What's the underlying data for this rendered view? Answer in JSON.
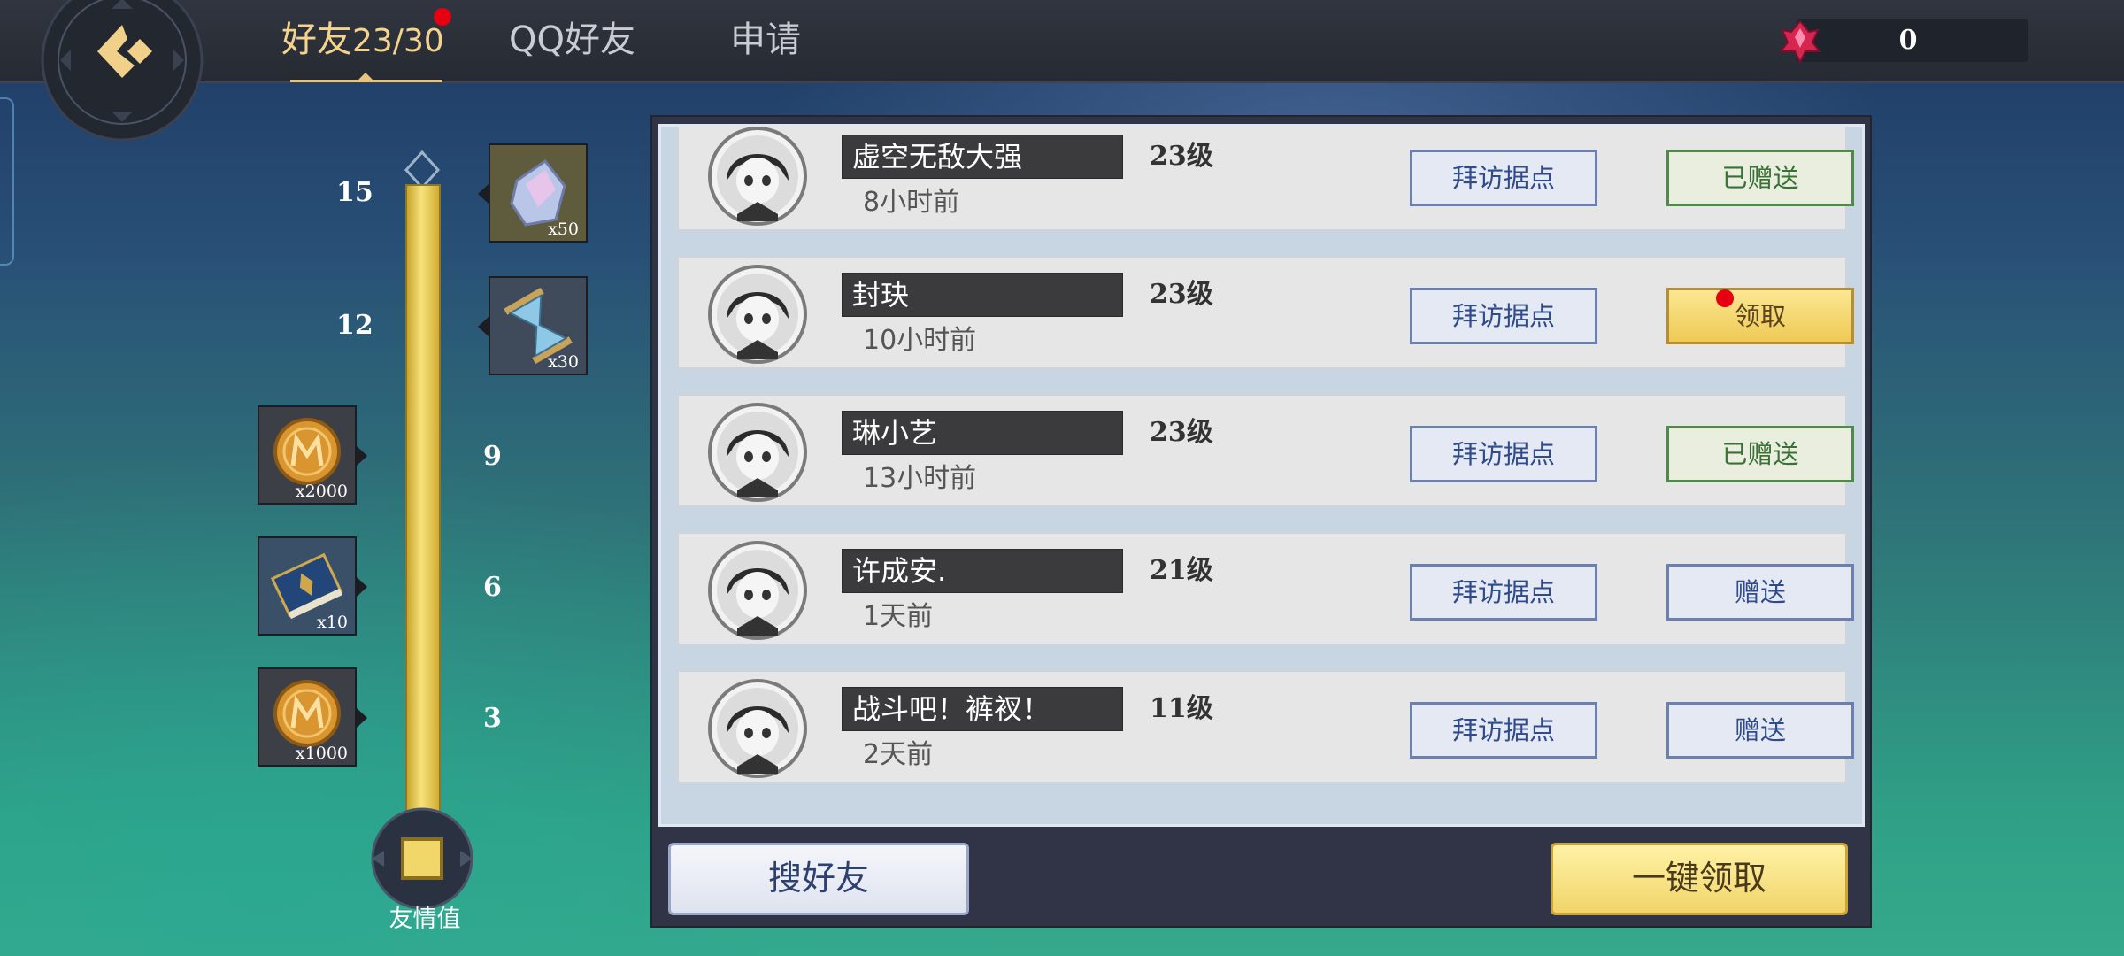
{
  "tabs": {
    "friends_label": "好友",
    "friends_count": "23/30",
    "qq_label": "QQ好友",
    "apply_label": "申请"
  },
  "currency": {
    "value": "0",
    "icon": "red-crystal-icon"
  },
  "friendship": {
    "label": "友情值",
    "milestones": [
      {
        "level": "15",
        "reward_qty": "x50",
        "icon": "crystal-icon"
      },
      {
        "level": "12",
        "reward_qty": "x30",
        "icon": "hourglass-icon"
      },
      {
        "level": "9",
        "reward_qty": "x2000",
        "icon": "gold-coin-icon"
      },
      {
        "level": "6",
        "reward_qty": "x10",
        "icon": "book-icon"
      },
      {
        "level": "3",
        "reward_qty": "x1000",
        "icon": "gold-coin-icon"
      }
    ]
  },
  "friends": [
    {
      "name": "虚空无敌大强",
      "time": "8小时前",
      "level": "23级",
      "visit_label": "拜访据点",
      "action_label": "已赠送",
      "action_state": "sent"
    },
    {
      "name": "封玦",
      "time": "10小时前",
      "level": "23级",
      "visit_label": "拜访据点",
      "action_label": "领取",
      "action_state": "claim"
    },
    {
      "name": "琳小艺",
      "time": "13小时前",
      "level": "23级",
      "visit_label": "拜访据点",
      "action_label": "已赠送",
      "action_state": "sent"
    },
    {
      "name": "许成安.",
      "time": "1天前",
      "level": "21级",
      "visit_label": "拜访据点",
      "action_label": "赠送",
      "action_state": "gift"
    },
    {
      "name": "战斗吧！裤衩！",
      "time": "2天前",
      "level": "11级",
      "visit_label": "拜访据点",
      "action_label": "赠送",
      "action_state": "gift"
    }
  ],
  "footer": {
    "search_label": "搜好友",
    "claim_all_label": "一键领取"
  },
  "colors": {
    "accent_gold": "#f4d48c",
    "notify_red": "#e60012",
    "sent_green": "#4f8a4b",
    "button_blue": "#6b7fb1"
  }
}
